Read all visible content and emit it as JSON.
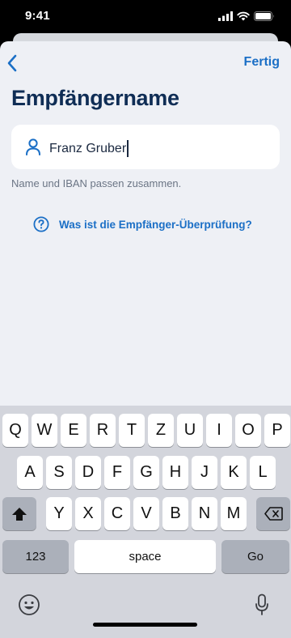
{
  "status_bar": {
    "time": "9:41",
    "icons": [
      "cellular-signal-icon",
      "wifi-icon",
      "battery-icon"
    ]
  },
  "nav": {
    "back_icon": "chevron-left-icon",
    "done_label": "Fertig"
  },
  "page": {
    "title": "Empfängername"
  },
  "name_field": {
    "icon": "person-icon",
    "value": "Franz Gruber",
    "hint": "Name und IBAN passen zusammen."
  },
  "help_link": {
    "icon": "question-circle-icon",
    "label": "Was ist die Empfänger-Überprüfung?"
  },
  "keyboard": {
    "row1": [
      "Q",
      "W",
      "E",
      "R",
      "T",
      "Z",
      "U",
      "I",
      "O",
      "P"
    ],
    "row2": [
      "A",
      "S",
      "D",
      "F",
      "G",
      "H",
      "J",
      "K",
      "L"
    ],
    "row3": [
      "Y",
      "X",
      "C",
      "V",
      "B",
      "N",
      "M"
    ],
    "numbers_label": "123",
    "space_label": "space",
    "go_label": "Go",
    "shift_icon": "shift-icon",
    "delete_icon": "backspace-icon",
    "emoji_icon": "emoji-icon",
    "mic_icon": "microphone-icon"
  },
  "colors": {
    "accent": "#1b6fc6",
    "title": "#0f2d55",
    "sheet_background": "#eef0f5",
    "keyboard_background": "#d3d5dc"
  }
}
